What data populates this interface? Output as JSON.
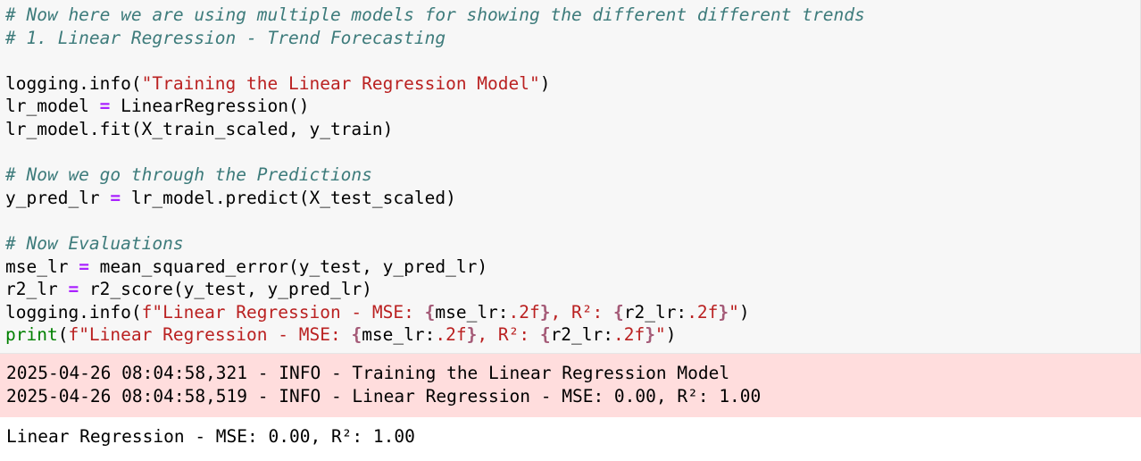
{
  "code": {
    "comment_1": "# Now here we are using multiple models for showing the different different trends",
    "comment_2": "# 1. Linear Regression - Trend Forecasting",
    "l4_fn": "logging.info(",
    "l4_str": "\"Training the Linear Regression Model\"",
    "l4_end": ")",
    "l5_var": "lr_model ",
    "l5_op": "=",
    "l5_rhs": " LinearRegression()",
    "l6": "lr_model.fit(X_train_scaled, y_train)",
    "comment_3": "# Now we go through the Predictions",
    "l9_var": "y_pred_lr ",
    "l9_op": "=",
    "l9_rhs": " lr_model.predict(X_test_scaled)",
    "comment_4": "# Now Evaluations",
    "l12_var": "mse_lr ",
    "l12_op": "=",
    "l12_rhs": " mean_squared_error(y_test, y_pred_lr)",
    "l13_var": "r2_lr ",
    "l13_op": "=",
    "l13_rhs": " r2_score(y_test, y_pred_lr)",
    "l14_fn": "logging.info(",
    "l15_fn": "print",
    "l15_paren": "(",
    "fstr_start": "f\"Linear Regression - MSE: ",
    "fstr_brace_open": "{",
    "fstr_mse": "mse_lr:",
    "fstr_fmt": ".2f",
    "fstr_brace_close": "}",
    "fstr_mid": ", R²: ",
    "fstr_r2": "r2_lr:",
    "fstr_end": "\"",
    "close_paren": ")"
  },
  "stderr_output": [
    "2025-04-26 08:04:58,321 - INFO - Training the Linear Regression Model",
    "2025-04-26 08:04:58,519 - INFO - Linear Regression - MSE: 0.00, R²: 1.00"
  ],
  "stdout_output": "Linear Regression - MSE: 0.00, R²: 1.00"
}
